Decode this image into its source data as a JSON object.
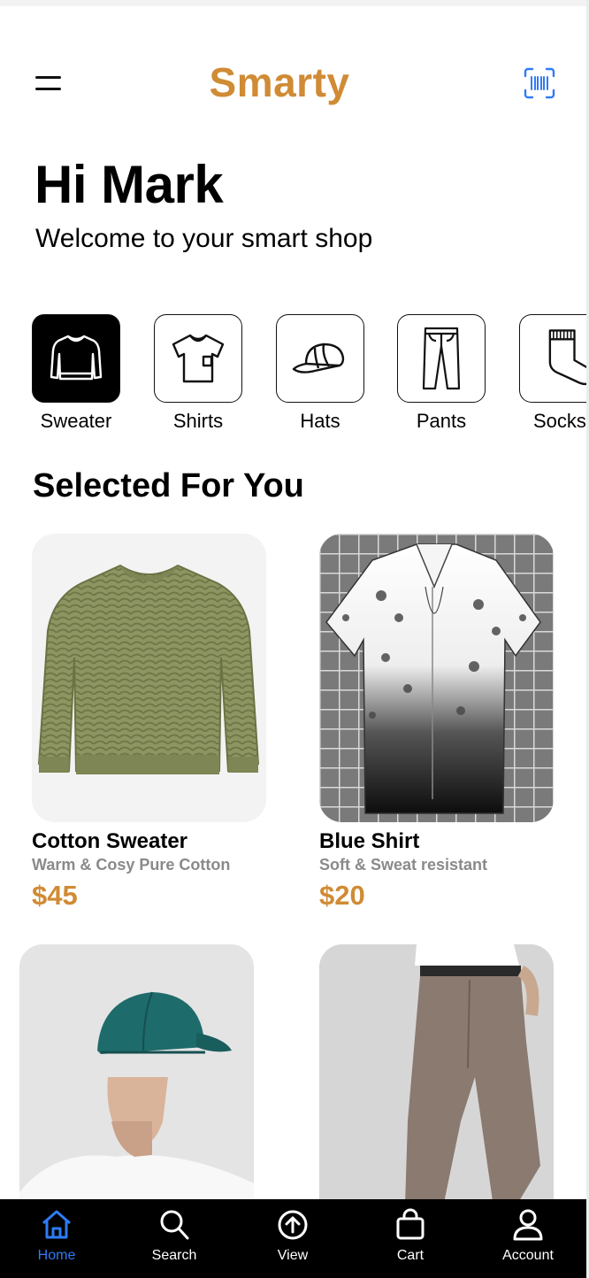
{
  "header": {
    "app_title": "Smarty",
    "menu_icon": "hamburger-icon",
    "scan_icon": "barcode-scan-icon",
    "scan_color": "#2f7bf5"
  },
  "greeting": {
    "title": "Hi Mark",
    "subtitle": "Welcome to your smart shop"
  },
  "categories": [
    {
      "label": "Sweater",
      "icon": "sweater-icon",
      "selected": true
    },
    {
      "label": "Shirts",
      "icon": "shirt-icon",
      "selected": false
    },
    {
      "label": "Hats",
      "icon": "cap-icon",
      "selected": false
    },
    {
      "label": "Pants",
      "icon": "pants-icon",
      "selected": false
    },
    {
      "label": "Socks",
      "icon": "sock-icon",
      "selected": false
    }
  ],
  "section_title": "Selected For You",
  "products": [
    {
      "name": "Cotton Sweater",
      "description": "Warm & Cosy Pure Cotton",
      "price": "$45"
    },
    {
      "name": "Blue Shirt",
      "description": "Soft & Sweat resistant",
      "price": "$20"
    },
    {
      "name": "",
      "description": "",
      "price": ""
    },
    {
      "name": "",
      "description": "",
      "price": ""
    }
  ],
  "bottom_nav": [
    {
      "label": "Home",
      "icon": "home-icon",
      "active": true
    },
    {
      "label": "Search",
      "icon": "search-icon",
      "active": false
    },
    {
      "label": "View",
      "icon": "upload-icon",
      "active": false
    },
    {
      "label": "Cart",
      "icon": "shopping-bag-icon",
      "active": false
    },
    {
      "label": "Account",
      "icon": "user-icon",
      "active": false
    }
  ],
  "colors": {
    "accent": "#d08b35",
    "active_nav": "#2f7bf5",
    "muted_text": "#8a8a8a"
  }
}
